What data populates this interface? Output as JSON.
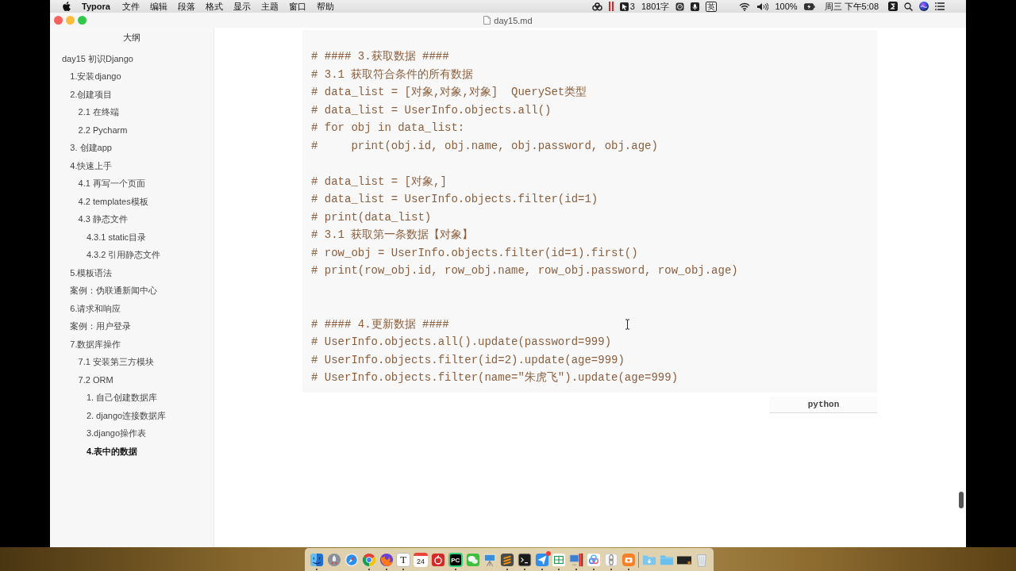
{
  "menu_bar": {
    "app_name": "Typora",
    "menus": [
      "文件",
      "编辑",
      "段落",
      "格式",
      "显示",
      "主题",
      "窗口",
      "帮助"
    ],
    "status": {
      "cursor_count": "3",
      "word_count": "1801字",
      "input_method": "英",
      "battery": "100%",
      "clock": "周三 下午5:08"
    }
  },
  "window": {
    "title": "day15.md"
  },
  "outline": {
    "title": "大纲",
    "items": [
      {
        "label": "day15 初识Django",
        "selected": false,
        "children": [
          {
            "label": "1.安装django",
            "selected": false
          },
          {
            "label": "2.创建项目",
            "selected": false,
            "children": [
              {
                "label": "2.1 在终端",
                "selected": false
              },
              {
                "label": "2.2 Pycharm",
                "selected": false
              }
            ]
          },
          {
            "label": "3. 创建app",
            "selected": false
          },
          {
            "label": "4.快速上手",
            "selected": false,
            "children": [
              {
                "label": "4.1 再写一个页面",
                "selected": false
              },
              {
                "label": "4.2 templates模板",
                "selected": false
              },
              {
                "label": "4.3 静态文件",
                "selected": false,
                "children": [
                  {
                    "label": "4.3.1 static目录",
                    "selected": false
                  },
                  {
                    "label": "4.3.2 引用静态文件",
                    "selected": false
                  }
                ]
              }
            ]
          },
          {
            "label": "5.模板语法",
            "selected": false
          },
          {
            "label": "案例：伪联通新闻中心",
            "selected": false
          },
          {
            "label": "6.请求和响应",
            "selected": false
          },
          {
            "label": "案例：用户登录",
            "selected": false
          },
          {
            "label": "7.数据库操作",
            "selected": false,
            "children": [
              {
                "label": "7.1 安装第三方模块",
                "selected": false
              },
              {
                "label": "7.2 ORM",
                "selected": false,
                "children": [
                  {
                    "label": "1. 自己创建数据库",
                    "selected": false
                  },
                  {
                    "label": "2. django连接数据库",
                    "selected": false
                  },
                  {
                    "label": "3.django操作表",
                    "selected": false
                  },
                  {
                    "label": "4.表中的数据",
                    "selected": true
                  }
                ]
              }
            ]
          }
        ]
      }
    ]
  },
  "code_block": {
    "language": "python",
    "lines": [
      {
        "kind": "code",
        "text": "# #### 3.获取数据 ####"
      },
      {
        "kind": "code",
        "text": "# 3.1 获取符合条件的所有数据"
      },
      {
        "kind": "code",
        "text": "# data_list = [对象,对象,对象]  QuerySet类型"
      },
      {
        "kind": "code",
        "text": "# data_list = UserInfo.objects.all()"
      },
      {
        "kind": "code",
        "text": "# for obj in data_list:"
      },
      {
        "kind": "code",
        "text": "#     print(obj.id, obj.name, obj.password, obj.age)"
      },
      {
        "kind": "blank"
      },
      {
        "kind": "code",
        "text": "# data_list = [对象,]"
      },
      {
        "kind": "code",
        "text": "# data_list = UserInfo.objects.filter(id=1)"
      },
      {
        "kind": "code",
        "text": "# print(data_list)"
      },
      {
        "kind": "code",
        "text": "# 3.1 获取第一条数据【对象】"
      },
      {
        "kind": "code",
        "text": "# row_obj = UserInfo.objects.filter(id=1).first()"
      },
      {
        "kind": "code",
        "text": "# print(row_obj.id, row_obj.name, row_obj.password, row_obj.age)"
      },
      {
        "kind": "blank"
      },
      {
        "kind": "blank"
      },
      {
        "kind": "code",
        "text": "# #### 4.更新数据 ####"
      },
      {
        "kind": "code",
        "text": "# UserInfo.objects.all().update(password=999)"
      },
      {
        "kind": "code",
        "text": "# UserInfo.objects.filter(id=2).update(age=999)"
      },
      {
        "kind": "code",
        "text": "# UserInfo.objects.filter(name=\"朱虎飞\").update(age=999)"
      }
    ]
  },
  "dock": {
    "apps": [
      {
        "kind": "finder",
        "running": true,
        "badge": false
      },
      {
        "kind": "rocket",
        "running": false,
        "badge": false
      },
      {
        "kind": "compass",
        "running": false,
        "badge": false
      },
      {
        "kind": "ring",
        "running": true,
        "badge": false
      },
      {
        "kind": "globe",
        "running": true,
        "badge": false
      },
      {
        "kind": "letter",
        "label": "T",
        "running": true,
        "badge": false
      },
      {
        "kind": "calendar",
        "label": "24",
        "running": false,
        "badge": false
      },
      {
        "kind": "disc",
        "running": false,
        "badge": false
      },
      {
        "kind": "ide",
        "label": "PC",
        "running": true,
        "badge": false
      },
      {
        "kind": "chat",
        "running": false,
        "badge": false
      },
      {
        "kind": "easel",
        "running": false,
        "badge": false
      },
      {
        "kind": "stripes",
        "running": true,
        "badge": false
      },
      {
        "kind": "terminal",
        "running": true,
        "badge": false
      },
      {
        "kind": "plane",
        "running": true,
        "badge": true
      },
      {
        "kind": "sheet",
        "running": true,
        "badge": false
      },
      {
        "kind": "monitor",
        "running": true,
        "badge": false
      },
      {
        "kind": "cloud",
        "running": true,
        "badge": false
      },
      {
        "kind": "chain",
        "running": true,
        "badge": false
      },
      {
        "kind": "camera",
        "running": true,
        "badge": false
      }
    ],
    "stacks": [
      {
        "kind": "downloads"
      },
      {
        "kind": "folder"
      },
      {
        "kind": "thumbnail"
      },
      {
        "kind": "trash"
      }
    ]
  }
}
